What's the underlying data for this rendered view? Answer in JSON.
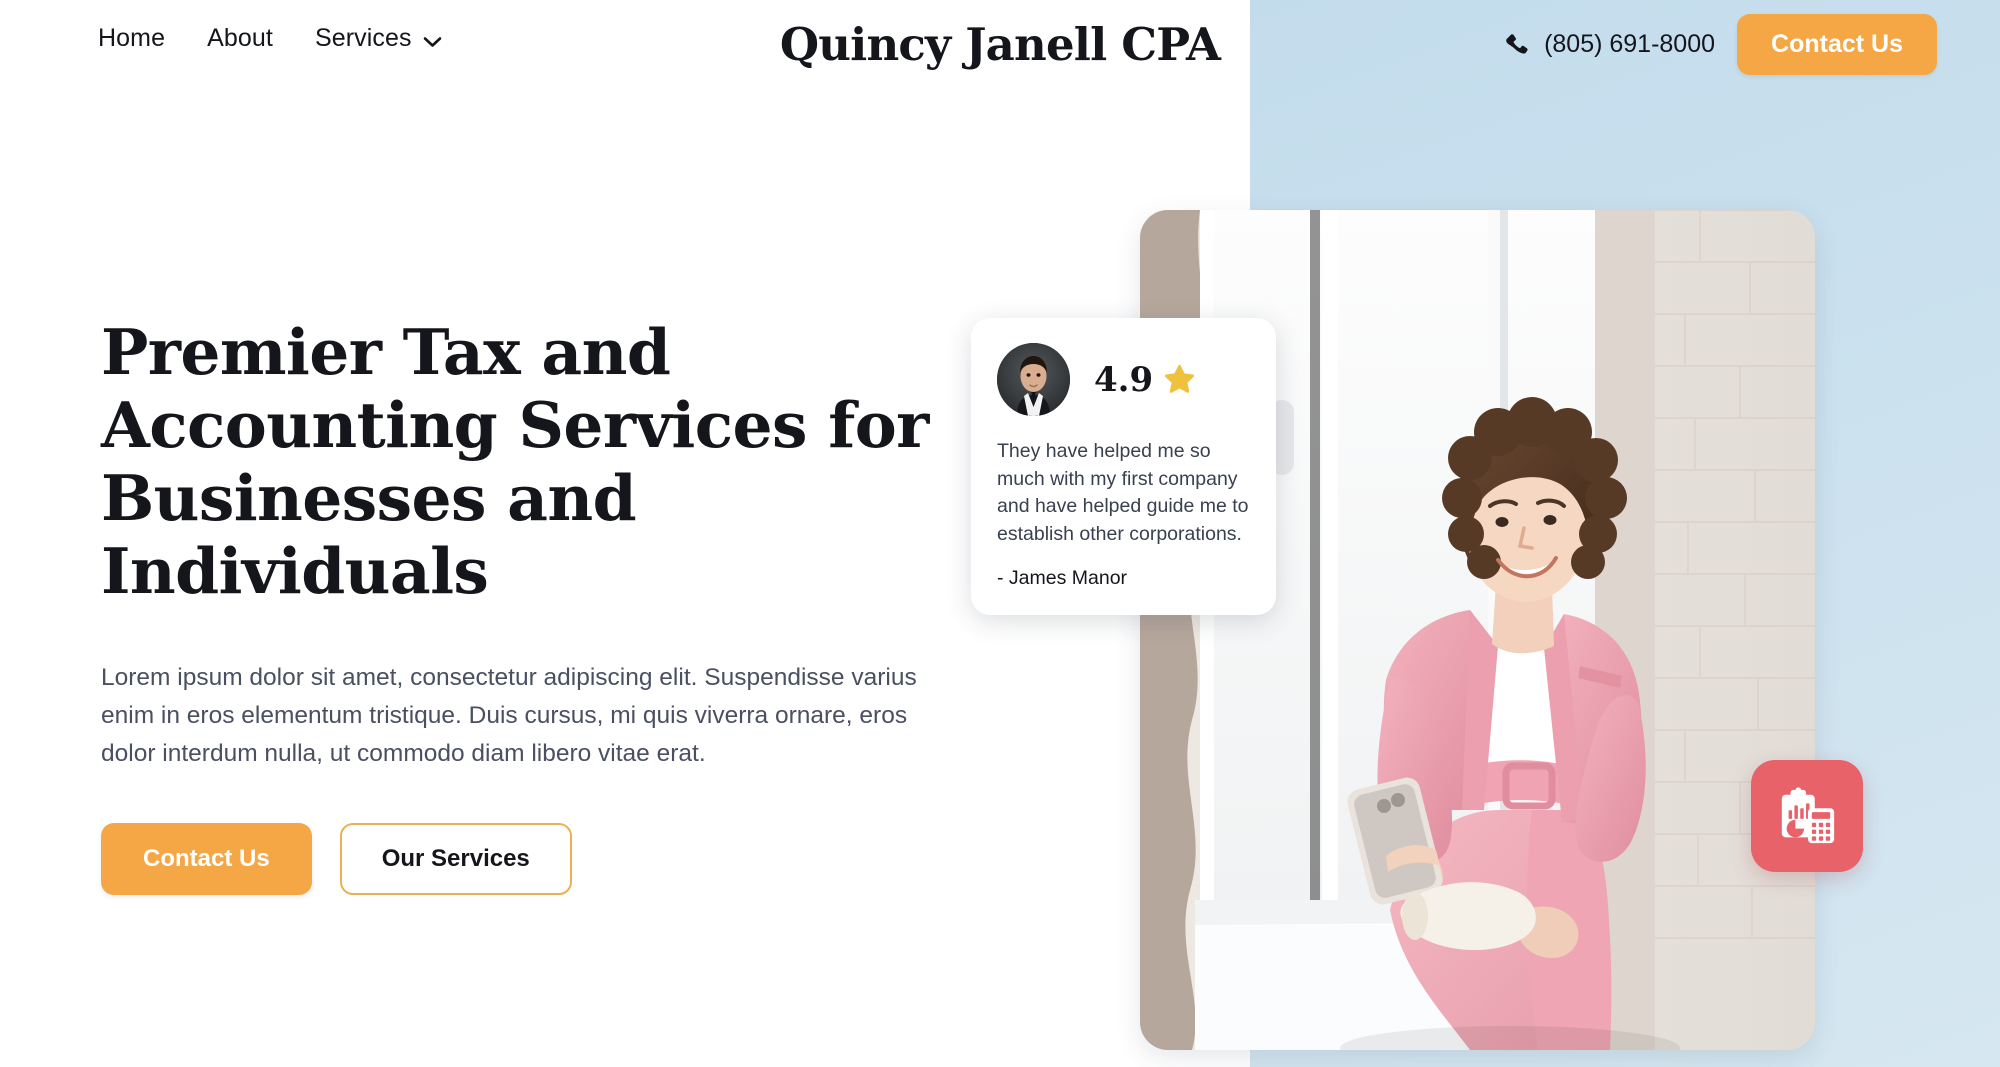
{
  "colors": {
    "accent_orange": "#F5A746",
    "panel_blue": "#CBE1EE",
    "badge_red": "#E8626A",
    "star_gold": "#EFC13D",
    "text_dark": "#14161C",
    "text_muted": "#4A5061",
    "outline_border": "#EAB254"
  },
  "header": {
    "nav": [
      {
        "label": "Home",
        "has_dropdown": false
      },
      {
        "label": "About",
        "has_dropdown": false
      },
      {
        "label": "Services",
        "has_dropdown": true
      }
    ],
    "brand": "Quincy Janell CPA",
    "phone_icon": "phone-icon",
    "phone": "(805) 691-8000",
    "cta_label": "Contact Us"
  },
  "hero": {
    "title": "Premier Tax and Accounting Services for Businesses and Individuals",
    "paragraph": "Lorem ipsum dolor sit amet, consectetur adipiscing elit. Suspendisse varius enim in eros elementum tristique. Duis cursus, mi quis viverra ornare, eros dolor interdum nulla, ut commodo diam libero vitae erat.",
    "primary_button": "Contact Us",
    "secondary_button": "Our Services"
  },
  "testimonial": {
    "avatar_name": "avatar",
    "rating": "4.9",
    "star_icon": "star-icon",
    "quote": "They have helped me so much with my first company and have helped guide me to establish other corporations.",
    "author": "- James Manor"
  },
  "badge": {
    "icon": "accounting-clipboard-calculator-icon"
  }
}
